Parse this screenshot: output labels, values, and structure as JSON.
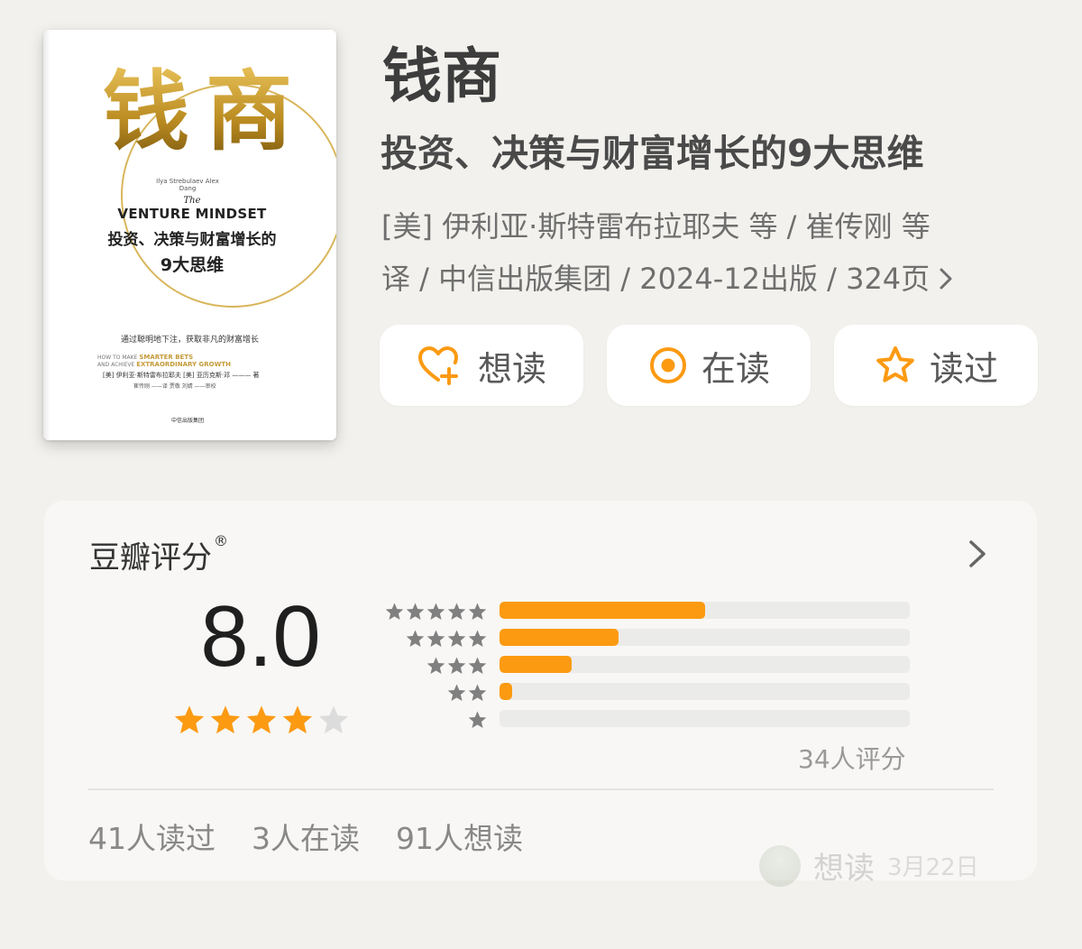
{
  "cover": {
    "title_char_1": "钱",
    "title_char_2": "商",
    "authors_en": "Ilya Strebulaev Alex Dang",
    "the": "The",
    "en_title": "VENTURE MINDSET",
    "cn_subtitle_1": "投资、决策与财富增长的",
    "cn_subtitle_2": "9大思维",
    "tagline": "通过聪明地下注，获取非凡的财富增长",
    "en_tag_1": "HOW TO MAKE",
    "en_tag_1b": "SMARTER BETS",
    "en_tag_2": "AND ACHIEVE",
    "en_tag_2b": "EXTRAORDINARY GROWTH",
    "authors_cn": "[美] 伊利亚·斯特雷布拉耶夫  [美] 亚历克斯·邓 ——— 著",
    "translators": "崔传刚 ——译  贾敬 刘婧 ——审校",
    "publisher": "中信出版集团"
  },
  "book": {
    "title": "钱商",
    "subtitle": "投资、决策与财富增长的9大思维",
    "meta_line_1": "[美] 伊利亚·斯特雷布拉耶夫 等 / 崔传刚 等",
    "meta_line_2": "译 / 中信出版集团 / 2024-12出版 / 324页"
  },
  "actions": {
    "want": "想读",
    "reading": "在读",
    "read": "读过"
  },
  "rating": {
    "label": "豆瓣评分",
    "registered": "®",
    "score": "8.0",
    "stars_filled": 4,
    "stars_total": 5,
    "distribution": [
      {
        "stars": 5,
        "fraction": 0.5
      },
      {
        "stars": 4,
        "fraction": 0.29
      },
      {
        "stars": 3,
        "fraction": 0.175
      },
      {
        "stars": 2,
        "fraction": 0.03
      },
      {
        "stars": 1,
        "fraction": 0.0
      }
    ],
    "count_text": "34人评分"
  },
  "stats": {
    "read": "41人读过",
    "reading": "3人在读",
    "want": "91人想读"
  },
  "toast": {
    "action": "想读",
    "date": "3月22日"
  },
  "colors": {
    "accent": "#fc9a12",
    "background": "#f2f1ed",
    "card": "#f8f7f5",
    "cover_gold": "#d9b65c"
  }
}
